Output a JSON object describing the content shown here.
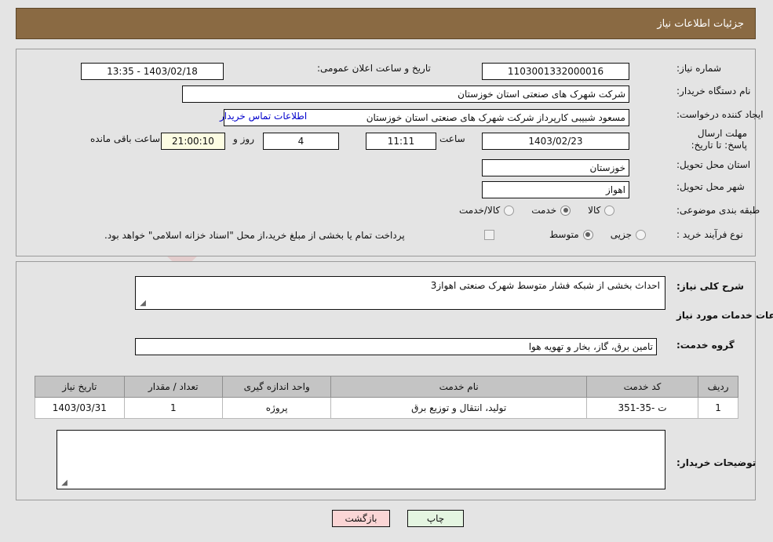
{
  "header": {
    "title": "جزئیات اطلاعات نیاز"
  },
  "top_form": {
    "need_number": {
      "label": "شماره نیاز:",
      "value": "1103001332000016"
    },
    "public_announce": {
      "label": "تاریخ و ساعت اعلان عمومی:",
      "value": "1403/02/18 - 13:35"
    },
    "buyer_org": {
      "label": "نام دستگاه خریدار:",
      "value": "شرکت شهرک های صنعتی استان خوزستان"
    },
    "requester": {
      "label": "ایجاد کننده درخواست:",
      "value": "مسعود شبیبی کارپرداز شرکت شهرک های صنعتی استان خوزستان"
    },
    "contact_link": "اطلاعات تماس خریدار",
    "deadline": {
      "label": "مهلت ارسال پاسخ: تا تاریخ:",
      "date": "1403/02/23",
      "time_label": "ساعت",
      "time": "11:11",
      "days": "4",
      "days_label": "روز و",
      "countdown": "21:00:10",
      "remaining_label": "ساعت باقی مانده"
    },
    "province": {
      "label": "استان محل تحویل:",
      "value": "خوزستان"
    },
    "city": {
      "label": "شهر محل تحویل:",
      "value": "اهواز"
    },
    "category": {
      "label": "طبقه بندی موضوعی:",
      "options": [
        {
          "label": "کالا",
          "selected": false
        },
        {
          "label": "خدمت",
          "selected": true
        },
        {
          "label": "کالا/خدمت",
          "selected": false
        }
      ]
    },
    "process_type": {
      "label": "نوع فرآیند خرید :",
      "options": [
        {
          "label": "جزیی",
          "selected": false
        },
        {
          "label": "متوسط",
          "selected": true
        }
      ],
      "note": "پرداخت تمام یا بخشی از مبلغ خرید،از محل \"اسناد خزانه اسلامی\" خواهد بود."
    }
  },
  "bottom_form": {
    "general_desc": {
      "label": "شرح کلی نیاز:",
      "value": "احداث بخشی از شبکه فشار متوسط شهرک صنعتی اهواز3"
    },
    "section_title": "اطلاعات خدمات مورد نیاز",
    "service_group": {
      "label": "گروه خدمت:",
      "value": "تامین برق، گاز، بخار و تهویه هوا"
    },
    "table": {
      "columns": [
        "ردیف",
        "کد خدمت",
        "نام خدمت",
        "واحد اندازه گیری",
        "تعداد / مقدار",
        "تاریخ نیاز"
      ],
      "rows": [
        {
          "row_no": "1",
          "service_code": "ت -35-351",
          "service_name": "تولید، انتقال و توزیع برق",
          "unit": "پروژه",
          "quantity": "1",
          "need_date": "1403/03/31"
        }
      ]
    },
    "buyer_notes": {
      "label": "توضیحات خریدار:",
      "value": ""
    }
  },
  "footer": {
    "back_button": "بازگشت",
    "print_button": "چاپ"
  },
  "watermark": {
    "text": "AriaTender.net"
  },
  "colors": {
    "header_bg": "#8a6a43",
    "page_bg": "#e4e4e4",
    "link": "#0000cc",
    "countdown_bg": "#fcfce2",
    "back_button_bg": "#fbd5d5",
    "print_button_bg": "#e4f5e1",
    "table_header_bg": "#c4c4c4"
  }
}
